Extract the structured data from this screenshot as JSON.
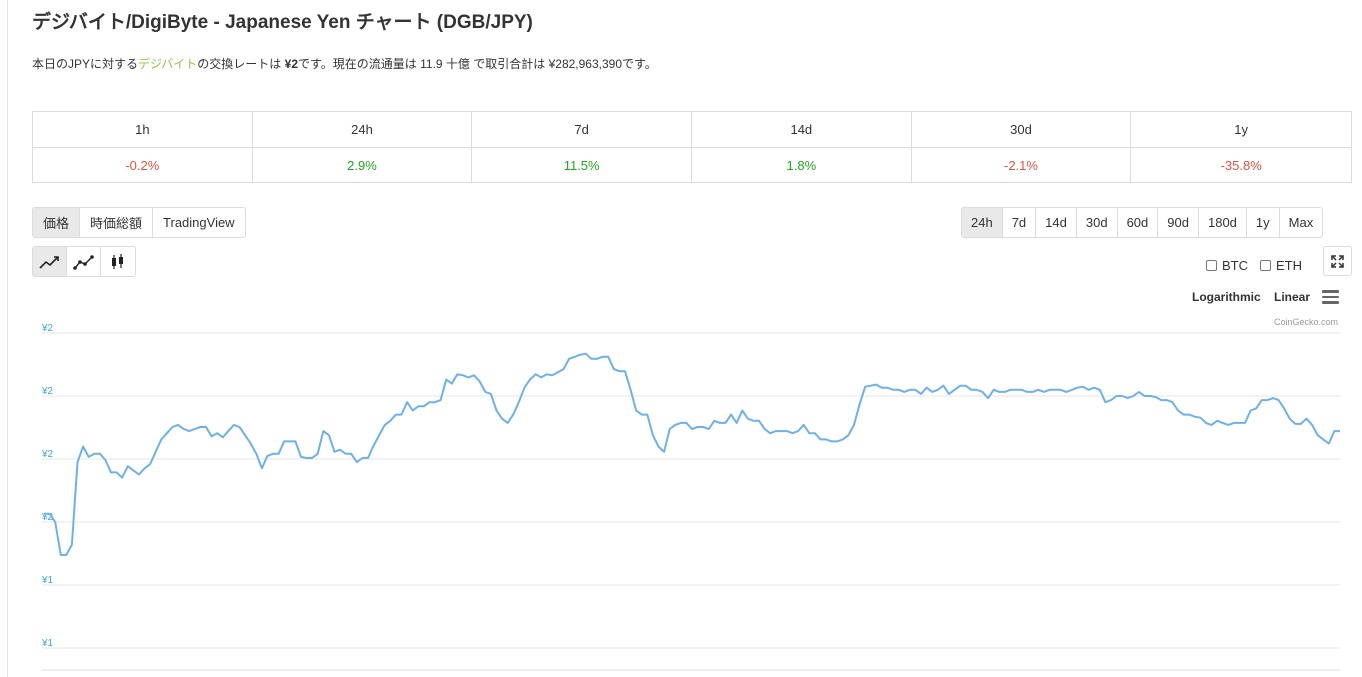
{
  "header": {
    "title": "デジバイト/DigiByte - Japanese Yen チャート (DGB/JPY)"
  },
  "description": {
    "part1": "本日のJPYに対する",
    "link": "デジバイト",
    "part2": "の交換レートは ",
    "price": "¥2",
    "part3": "です。現在の流通量は 11.9 十億 で取引合計は ¥282,963,390です。"
  },
  "performance": {
    "headers": [
      "1h",
      "24h",
      "7d",
      "14d",
      "30d",
      "1y"
    ],
    "values": [
      "-0.2%",
      "2.9%",
      "11.5%",
      "1.8%",
      "-2.1%",
      "-35.8%"
    ],
    "colors": {
      "negative": "#e15241",
      "positive": "#21a81c"
    }
  },
  "view_tabs": [
    "価格",
    "時価総額",
    "TradingView"
  ],
  "active_view_tab": "価格",
  "time_ranges": [
    "24h",
    "7d",
    "14d",
    "30d",
    "60d",
    "90d",
    "180d",
    "1y",
    "Max"
  ],
  "active_time_range": "24h",
  "chart_type_icons": [
    "line-chart-icon",
    "line-points-chart-icon",
    "candlestick-chart-icon"
  ],
  "compare": {
    "btc": "BTC",
    "eth": "ETH"
  },
  "scale": {
    "log": "Logarithmic",
    "linear": "Linear"
  },
  "credits": "CoinGecko.com",
  "chart_data": {
    "type": "line",
    "title": "",
    "xlabel": "",
    "ylabel": "",
    "line_color": "#6eb0e8",
    "ytick_labels": [
      "¥2",
      "¥2",
      "¥2",
      "¥2",
      "¥1",
      "¥1"
    ],
    "ylim": [
      1.65,
      1.955
    ],
    "grid": true,
    "y": [
      1.78,
      1.78,
      1.772,
      1.74,
      1.74,
      1.75,
      1.83,
      1.845,
      1.835,
      1.838,
      1.838,
      1.832,
      1.82,
      1.82,
      1.815,
      1.826,
      1.822,
      1.818,
      1.824,
      1.828,
      1.84,
      1.852,
      1.858,
      1.864,
      1.866,
      1.862,
      1.86,
      1.862,
      1.864,
      1.864,
      1.855,
      1.858,
      1.854,
      1.86,
      1.866,
      1.864,
      1.856,
      1.848,
      1.838,
      1.824,
      1.836,
      1.838,
      1.838,
      1.85,
      1.85,
      1.85,
      1.835,
      1.834,
      1.834,
      1.838,
      1.86,
      1.856,
      1.84,
      1.842,
      1.838,
      1.838,
      1.83,
      1.834,
      1.834,
      1.846,
      1.856,
      1.866,
      1.87,
      1.876,
      1.876,
      1.888,
      1.88,
      1.884,
      1.884,
      1.888,
      1.888,
      1.89,
      1.91,
      1.906,
      1.915,
      1.914,
      1.912,
      1.914,
      1.908,
      1.898,
      1.896,
      1.88,
      1.872,
      1.868,
      1.876,
      1.888,
      1.902,
      1.91,
      1.915,
      1.912,
      1.915,
      1.914,
      1.917,
      1.92,
      1.93,
      1.932,
      1.934,
      1.935,
      1.93,
      1.93,
      1.932,
      1.932,
      1.92,
      1.918,
      1.918,
      1.9,
      1.88,
      1.876,
      1.876,
      1.856,
      1.845,
      1.84,
      1.862,
      1.866,
      1.868,
      1.868,
      1.862,
      1.864,
      1.864,
      1.862,
      1.87,
      1.868,
      1.868,
      1.876,
      1.868,
      1.88,
      1.872,
      1.87,
      1.87,
      1.862,
      1.858,
      1.86,
      1.86,
      1.86,
      1.858,
      1.86,
      1.866,
      1.858,
      1.858,
      1.852,
      1.852,
      1.85,
      1.85,
      1.852,
      1.856,
      1.866,
      1.886,
      1.903,
      1.904,
      1.905,
      1.902,
      1.902,
      1.9,
      1.9,
      1.898,
      1.9,
      1.9,
      1.896,
      1.902,
      1.898,
      1.9,
      1.904,
      1.896,
      1.9,
      1.904,
      1.904,
      1.9,
      1.9,
      1.898,
      1.892,
      1.9,
      1.898,
      1.898,
      1.9,
      1.9,
      1.9,
      1.898,
      1.898,
      1.9,
      1.898,
      1.9,
      1.9,
      1.9,
      1.898,
      1.9,
      1.902,
      1.903,
      1.9,
      1.902,
      1.9,
      1.888,
      1.89,
      1.894,
      1.894,
      1.892,
      1.894,
      1.898,
      1.894,
      1.894,
      1.893,
      1.89,
      1.89,
      1.888,
      1.88,
      1.876,
      1.876,
      1.874,
      1.873,
      1.868,
      1.866,
      1.87,
      1.868,
      1.866,
      1.868,
      1.868,
      1.868,
      1.88,
      1.882,
      1.89,
      1.89,
      1.892,
      1.89,
      1.882,
      1.872,
      1.867,
      1.867,
      1.872,
      1.866,
      1.856,
      1.852,
      1.848,
      1.86,
      1.86
    ]
  }
}
